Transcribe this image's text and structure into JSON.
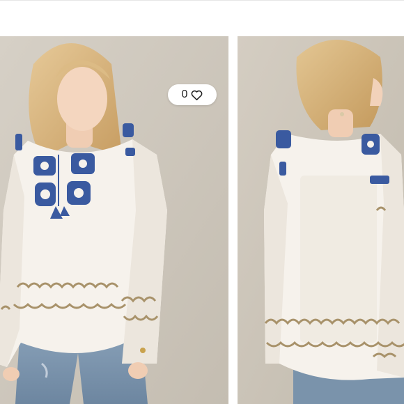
{
  "listing": {
    "like_count": "0",
    "icons": {
      "like": "heart-outline-icon"
    },
    "photos": [
      {
        "view": "front"
      },
      {
        "view": "back"
      }
    ]
  },
  "colors": {
    "backdrop": "#cfc9bf",
    "blouse": "#f6f2ec",
    "embroidery_blue": "#3a5aa0",
    "embroidery_gold": "#a8926a",
    "denim": "#7d95ac",
    "hair": "#d9b67e"
  }
}
